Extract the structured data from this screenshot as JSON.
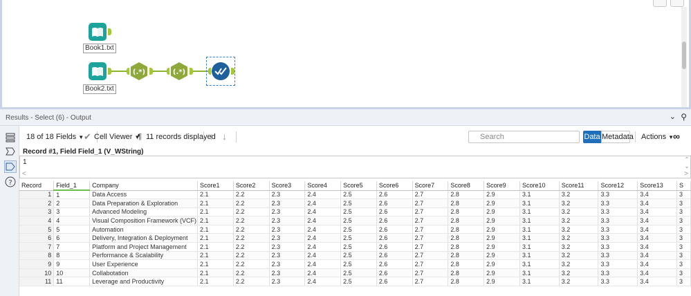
{
  "canvas": {
    "tools": [
      {
        "label": "Book1.txt"
      },
      {
        "label": "Book2.txt"
      }
    ]
  },
  "results": {
    "title": "Results - Select (6) - Output"
  },
  "toolbar": {
    "fields_label": "18 of 18 Fields",
    "viewer_label": "Cell Viewer",
    "records_label": "11 records displayed",
    "search_placeholder": "Search",
    "data_label": "Data",
    "metadata_label": "Metadata",
    "actions_label": "Actions"
  },
  "record_info": "Record #1, Field Field_1 (V_WString)",
  "cell_value": "1",
  "grid": {
    "columns": [
      "Record",
      "Field_1",
      "Company",
      "Score1",
      "Score2",
      "Score3",
      "Score4",
      "Score5",
      "Score6",
      "Score7",
      "Score8",
      "Score9",
      "Score10",
      "Score11",
      "Score12",
      "Score13",
      "S"
    ],
    "rows": [
      [
        "1",
        "1",
        "Data Access",
        "2.1",
        "2.2",
        "2.3",
        "2.4",
        "2.5",
        "2.6",
        "2.7",
        "2.8",
        "2.9",
        "3.1",
        "3.2",
        "3.3",
        "3.4",
        "3"
      ],
      [
        "2",
        "2",
        "Data Preparation & Exploration",
        "2.1",
        "2.2",
        "2.3",
        "2.4",
        "2.5",
        "2.6",
        "2.7",
        "2.8",
        "2.9",
        "3.1",
        "3.2",
        "3.3",
        "3.4",
        "3"
      ],
      [
        "3",
        "3",
        "Advanced Modeling",
        "2.1",
        "2.2",
        "2.3",
        "2.4",
        "2.5",
        "2.6",
        "2.7",
        "2.8",
        "2.9",
        "3.1",
        "3.2",
        "3.3",
        "3.4",
        "3"
      ],
      [
        "4",
        "4",
        "Visual Composition Framework (VCF)",
        "2.1",
        "2.2",
        "2.3",
        "2.4",
        "2.5",
        "2.6",
        "2.7",
        "2.8",
        "2.9",
        "3.1",
        "3.2",
        "3.3",
        "3.4",
        "3"
      ],
      [
        "5",
        "5",
        "Automation",
        "2.1",
        "2.2",
        "2.3",
        "2.4",
        "2.5",
        "2.6",
        "2.7",
        "2.8",
        "2.9",
        "3.1",
        "3.2",
        "3.3",
        "3.4",
        "3"
      ],
      [
        "6",
        "6",
        "Delivery, Integration & Deployment",
        "2.1",
        "2.2",
        "2.3",
        "2.4",
        "2.5",
        "2.6",
        "2.7",
        "2.8",
        "2.9",
        "3.1",
        "3.2",
        "3.3",
        "3.4",
        "3"
      ],
      [
        "7",
        "7",
        "Platform and Project Management",
        "2.1",
        "2.2",
        "2.3",
        "2.4",
        "2.5",
        "2.6",
        "2.7",
        "2.8",
        "2.9",
        "3.1",
        "3.2",
        "3.3",
        "3.4",
        "3"
      ],
      [
        "8",
        "8",
        "Performance & Scalability",
        "2.1",
        "2.2",
        "2.3",
        "2.4",
        "2.5",
        "2.6",
        "2.7",
        "2.8",
        "2.9",
        "3.1",
        "3.2",
        "3.3",
        "3.4",
        "3"
      ],
      [
        "9",
        "9",
        "User Experience",
        "2.1",
        "2.2",
        "2.3",
        "2.4",
        "2.5",
        "2.6",
        "2.7",
        "2.8",
        "2.9",
        "3.1",
        "3.2",
        "3.3",
        "3.4",
        "3"
      ],
      [
        "10",
        "10",
        "Collabotation",
        "2.1",
        "2.2",
        "2.3",
        "2.4",
        "2.5",
        "2.6",
        "2.7",
        "2.8",
        "2.9",
        "3.1",
        "3.2",
        "3.3",
        "3.4",
        "3"
      ],
      [
        "11",
        "11",
        "Leverage and Productivity",
        "2.1",
        "2.2",
        "2.3",
        "2.4",
        "2.5",
        "2.6",
        "2.7",
        "2.8",
        "2.9",
        "3.1",
        "3.2",
        "3.3",
        "3.4",
        "3"
      ]
    ]
  },
  "colors": {
    "input_tool": "#1ba39c",
    "regex_tool": "#8fa83a",
    "select_tool": "#1f5f9e",
    "connector": "#8db32f",
    "data_button": "#1f6fbd"
  }
}
